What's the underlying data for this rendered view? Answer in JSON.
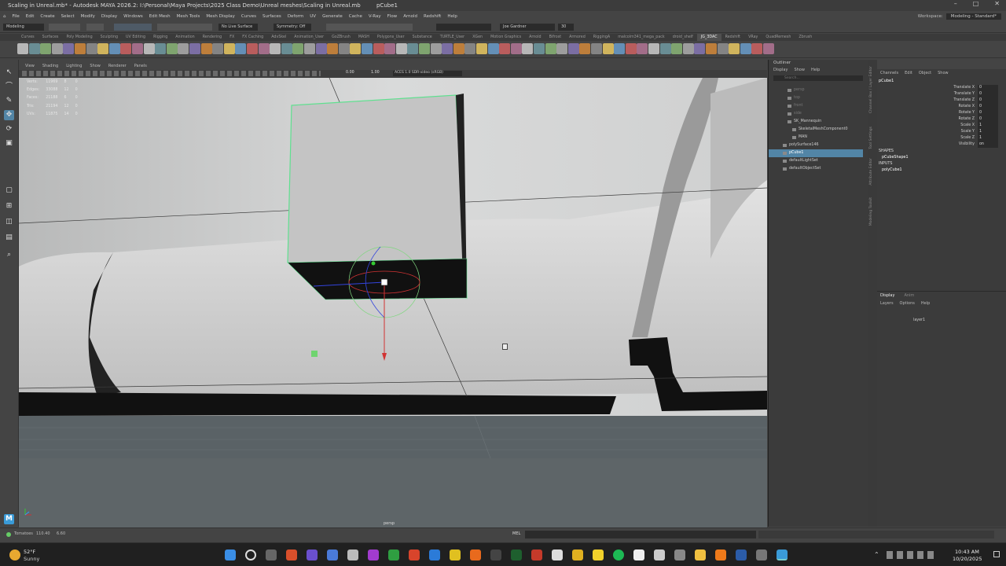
{
  "title_bar": {
    "title": "Scaling in Unreal.mb* - Autodesk MAYA 2026.2: I:\\Personal\\Maya Projects\\2025 Class Demo\\Unreal meshes\\Scaling in Unreal.mb",
    "selection": "pCube1",
    "controls": [
      "–",
      "□",
      "✕"
    ]
  },
  "menu": {
    "items": [
      "File",
      "Edit",
      "Create",
      "Select",
      "Modify",
      "Display",
      "Windows",
      "Edit Mesh",
      "Mesh Tools",
      "Mesh Display",
      "Curves",
      "Surfaces",
      "Deform",
      "UV",
      "Generate",
      "Cache",
      "V-Ray",
      "Flow",
      "Arnold",
      "Redshift",
      "Help"
    ],
    "workspace_label": "Workspace:",
    "workspace_value": "Modeling - Standard*"
  },
  "status_line": {
    "mode": "Modeling",
    "live_surface": "No Live Surface",
    "symmetry": "Symmetry: Off",
    "user": "Joe Gardner",
    "frame_field": "30"
  },
  "shelf_tabs": [
    "Curves",
    "Surfaces",
    "Poly Modeling",
    "Sculpting",
    "UV Editing",
    "Rigging",
    "Animation",
    "Rendering",
    "FX",
    "FX Caching",
    "AdvSkel",
    "Animation_User",
    "GoZBrush",
    "MASH",
    "Polygons_User",
    "Substance",
    "TURTLE_User",
    "XGen",
    "Motion Graphics",
    "Arnold",
    "Bifrost",
    "Armored",
    "RiggingA",
    "malcolm341_mega_pack",
    "droid_shelf",
    "JG_3DAC",
    "Redshift",
    "VRay",
    "QuadRemesh",
    "Zbrush"
  ],
  "shelf_active": "JG_3DAC",
  "viewport": {
    "menu": [
      "View",
      "Shading",
      "Lighting",
      "Show",
      "Renderer",
      "Panels"
    ],
    "near_clip": "0.00",
    "far_clip": "1.00",
    "color_space": "ACES 1.0 SDR-video (sRGB)",
    "camera_label": "persp",
    "hud": [
      {
        "label": "Verts:",
        "a": "11969",
        "b": "8",
        "c": "0"
      },
      {
        "label": "Edges:",
        "a": "33088",
        "b": "12",
        "c": "0"
      },
      {
        "label": "Faces:",
        "a": "21188",
        "b": "6",
        "c": "0"
      },
      {
        "label": "Tris:",
        "a": "21194",
        "b": "12",
        "c": "0"
      },
      {
        "label": "UVs:",
        "a": "11875",
        "b": "14",
        "c": "0"
      }
    ]
  },
  "outliner": {
    "title": "Outliner",
    "menu": [
      "Display",
      "Show",
      "Help"
    ],
    "search_placeholder": "Search...",
    "items": [
      {
        "label": "persp",
        "indent": 1,
        "dim": true
      },
      {
        "label": "top",
        "indent": 1,
        "dim": true
      },
      {
        "label": "front",
        "indent": 1,
        "dim": true
      },
      {
        "label": "side",
        "indent": 1,
        "dim": true
      },
      {
        "label": "SK_Mannequin",
        "indent": 1,
        "dim": false
      },
      {
        "label": "SkeletalMeshComponent0",
        "indent": 2,
        "dim": false
      },
      {
        "label": "MAN",
        "indent": 2,
        "dim": false
      },
      {
        "label": "polySurface146",
        "indent": 0,
        "dim": false
      },
      {
        "label": "pCube1",
        "indent": 0,
        "dim": false,
        "selected": true
      },
      {
        "label": "defaultLightSet",
        "indent": 0,
        "dim": false
      },
      {
        "label": "defaultObjectSet",
        "indent": 0,
        "dim": false
      }
    ]
  },
  "side_tabs": [
    "Channel Box / Layer Editor",
    "Tool Settings",
    "Attribute Editor",
    "Modeling Toolkit"
  ],
  "channel_box": {
    "menu": [
      "Channels",
      "Edit",
      "Object",
      "Show"
    ],
    "object": "pCube1",
    "channels": [
      {
        "name": "Translate X",
        "value": "0"
      },
      {
        "name": "Translate Y",
        "value": "0"
      },
      {
        "name": "Translate Z",
        "value": "0"
      },
      {
        "name": "Rotate X",
        "value": "0"
      },
      {
        "name": "Rotate Y",
        "value": "0"
      },
      {
        "name": "Rotate Z",
        "value": "0"
      },
      {
        "name": "Scale X",
        "value": "1"
      },
      {
        "name": "Scale Y",
        "value": "1"
      },
      {
        "name": "Scale Z",
        "value": "1"
      },
      {
        "name": "Visibility",
        "value": "on"
      }
    ],
    "shapes_label": "SHAPES",
    "shape": "pCubeShape1",
    "inputs_label": "INPUTS",
    "input": "polyCube1"
  },
  "layer_editor": {
    "tabs": [
      "Display",
      "Anim"
    ],
    "menu": [
      "Layers",
      "Options",
      "Help"
    ],
    "layer": "layer1"
  },
  "bottom_bar": {
    "frame_info": "Tomatoes",
    "frame_a": "110.40",
    "frame_b": "6.60",
    "mel_label": "MEL"
  },
  "taskbar": {
    "weather_temp": "52°F",
    "weather_desc": "Sunny",
    "time": "10:43 AM",
    "date": "10/20/2025"
  }
}
